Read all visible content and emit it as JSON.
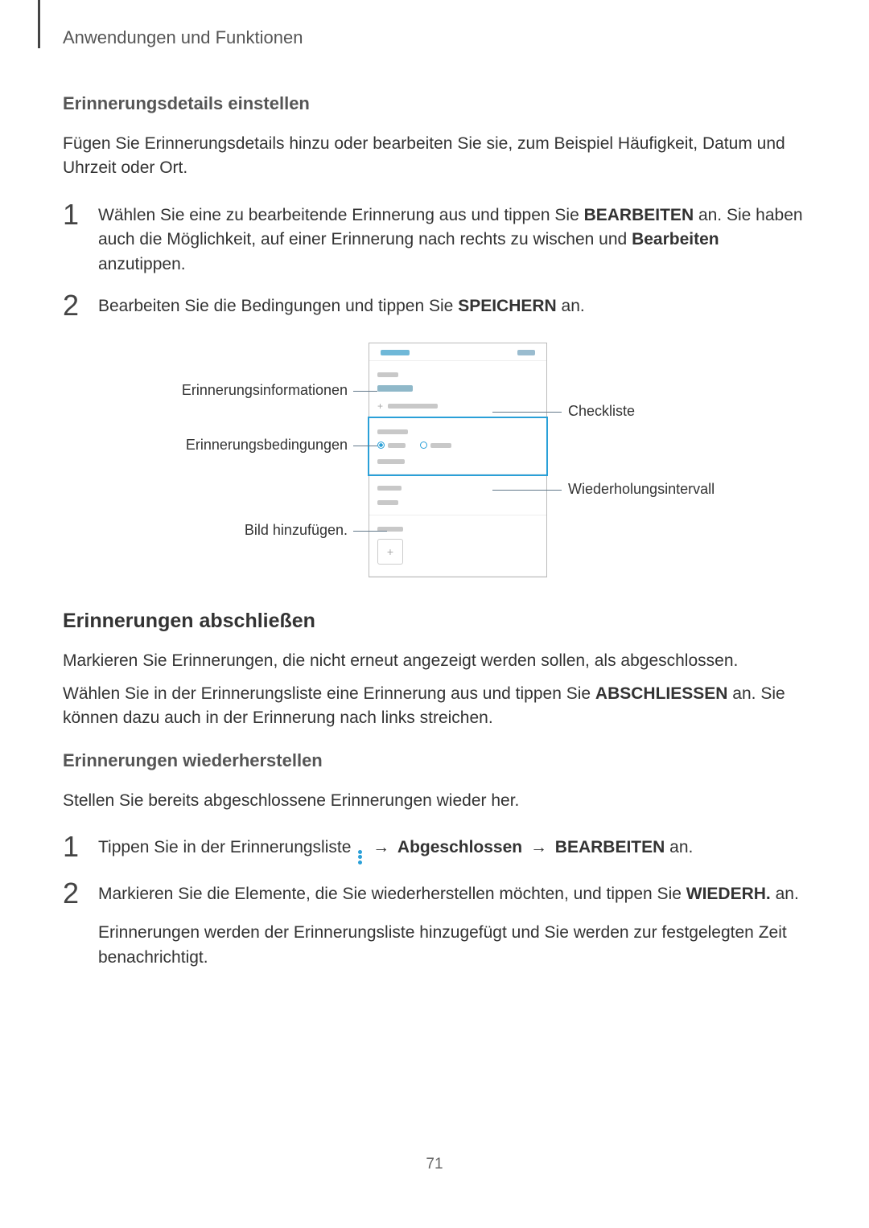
{
  "breadcrumb": "Anwendungen und Funktionen",
  "sec1": {
    "heading": "Erinnerungsdetails einstellen",
    "intro": "Fügen Sie Erinnerungsdetails hinzu oder bearbeiten Sie sie, zum Beispiel Häufigkeit, Datum und Uhrzeit oder Ort.",
    "step1a": "Wählen Sie eine zu bearbeitende Erinnerung aus und tippen Sie ",
    "step1_bold1": "BEARBEITEN",
    "step1b": " an. Sie haben auch die Möglichkeit, auf einer Erinnerung nach rechts zu wischen und ",
    "step1_bold2": "Bearbeiten",
    "step1c": " anzutippen.",
    "step2a": "Bearbeiten Sie die Bedingungen und tippen Sie ",
    "step2_bold": "SPEICHERN",
    "step2b": " an."
  },
  "diagram": {
    "left1": "Erinnerungsinformationen",
    "left2": "Erinnerungsbedingungen",
    "left3": "Bild hinzufügen.",
    "right1": "Checkliste",
    "right2": "Wiederholungsintervall"
  },
  "sec2": {
    "heading": "Erinnerungen abschließen",
    "p1": "Markieren Sie Erinnerungen, die nicht erneut angezeigt werden sollen, als abgeschlossen.",
    "p2a": "Wählen Sie in der Erinnerungsliste eine Erinnerung aus und tippen Sie ",
    "p2_bold": "ABSCHLIESSEN",
    "p2b": " an. Sie können dazu auch in der Erinnerung nach links streichen."
  },
  "sec3": {
    "heading": "Erinnerungen wiederherstellen",
    "intro": "Stellen Sie bereits abgeschlossene Erinnerungen wieder her.",
    "step1a": "Tippen Sie in der Erinnerungsliste ",
    "step1_arrow1": " → ",
    "step1_bold1": "Abgeschlossen",
    "step1_arrow2": " → ",
    "step1_bold2": "BEARBEITEN",
    "step1b": " an.",
    "step2a": "Markieren Sie die Elemente, die Sie wiederherstellen möchten, und tippen Sie ",
    "step2_bold": "WIEDERH.",
    "step2b": " an.",
    "step2_sub": "Erinnerungen werden der Erinnerungsliste hinzugefügt und Sie werden zur festgelegten Zeit benachrichtigt."
  },
  "page_num": "71"
}
